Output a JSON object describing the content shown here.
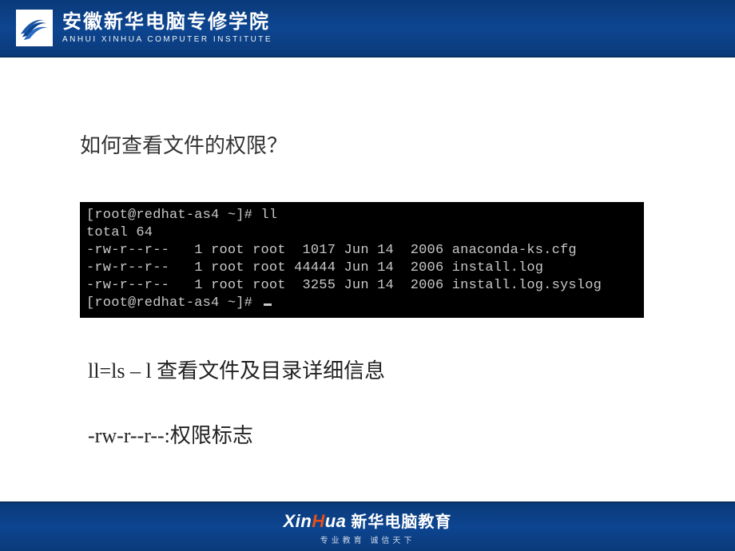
{
  "header": {
    "title_cn": "安徽新华电脑专修学院",
    "title_en": "ANHUI XINHUA COMPUTER INSTITUTE"
  },
  "slide": {
    "question": "如何查看文件的权限？",
    "terminal": {
      "prompt1": "[root@redhat-as4 ~]# ll",
      "total": "total 64",
      "rows": [
        {
          "perm": "-rw-r--r--",
          "links": "1",
          "owner": "root",
          "group": "root",
          "size": "1017",
          "date": "Jun 14",
          "year": "2006",
          "name": "anaconda-ks.cfg"
        },
        {
          "perm": "-rw-r--r--",
          "links": "1",
          "owner": "root",
          "group": "root",
          "size": "44444",
          "date": "Jun 14",
          "year": "2006",
          "name": "install.log"
        },
        {
          "perm": "-rw-r--r--",
          "links": "1",
          "owner": "root",
          "group": "root",
          "size": "3255",
          "date": "Jun 14",
          "year": "2006",
          "name": "install.log.syslog"
        }
      ],
      "prompt2": "[root@redhat-as4 ~]# "
    },
    "note1": "ll=ls – l 查看文件及目录详细信息",
    "note2": "-rw-r--r--:权限标志"
  },
  "footer": {
    "brand_en_prefix": "Xin",
    "brand_en_h": "H",
    "brand_en_suffix": "ua",
    "brand_cn": "新华电脑教育",
    "tagline": "专业教育  诚信天下"
  }
}
